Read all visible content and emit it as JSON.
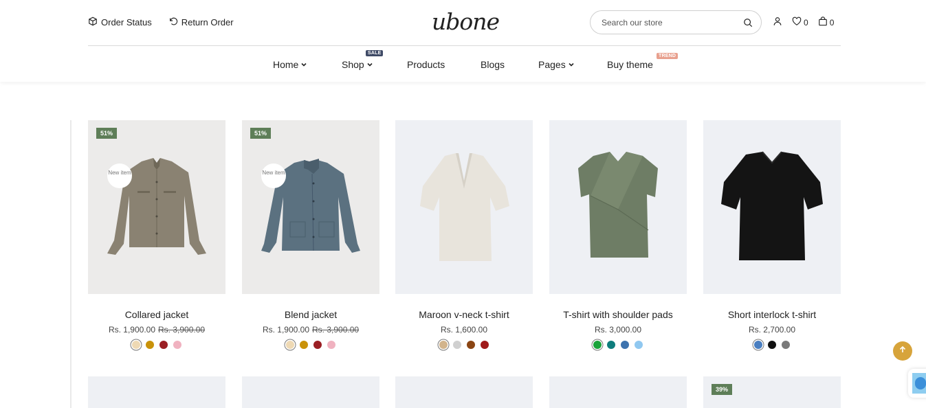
{
  "header": {
    "top_links": [
      {
        "label": "Order Status",
        "icon": "box-icon"
      },
      {
        "label": "Return Order",
        "icon": "undo-icon"
      }
    ],
    "logo": {
      "text": "ubone",
      "dot_color": "#d9a441"
    },
    "search": {
      "placeholder": "Search our store",
      "value": ""
    },
    "wishlist_count": "0",
    "cart_count": "0"
  },
  "nav": {
    "items": [
      {
        "label": "Home",
        "has_dropdown": true
      },
      {
        "label": "Shop",
        "has_dropdown": true,
        "tag": "SALE"
      },
      {
        "label": "Products",
        "has_dropdown": false
      },
      {
        "label": "Blogs",
        "has_dropdown": false
      },
      {
        "label": "Pages",
        "has_dropdown": true
      },
      {
        "label": "Buy theme",
        "has_dropdown": false,
        "tag": "TREND"
      }
    ]
  },
  "products": [
    {
      "title": "Collared jacket",
      "price": "Rs. 1,900.00",
      "old_price": "Rs. 3,900.00",
      "badge": "51%",
      "new_tag": "New item",
      "colors": [
        "#eed9b4",
        "#c9920a",
        "#9b1f24",
        "#f0b2c0"
      ],
      "garment": "jacket-taupe"
    },
    {
      "title": "Blend jacket",
      "price": "Rs. 1,900.00",
      "old_price": "Rs. 3,900.00",
      "badge": "51%",
      "new_tag": "New item",
      "colors": [
        "#eed9b4",
        "#c9920a",
        "#9b1f24",
        "#f0b2c0"
      ],
      "garment": "jacket-blue"
    },
    {
      "title": "Maroon v-neck t-shirt",
      "price": "Rs. 1,600.00",
      "old_price": "",
      "badge": "",
      "new_tag": "",
      "colors": [
        "#d2b48c",
        "#d0d0d0",
        "#8b4513",
        "#a01a1a"
      ],
      "garment": "tee-cream"
    },
    {
      "title": "T-shirt with shoulder pads",
      "price": "Rs. 3,000.00",
      "old_price": "",
      "badge": "",
      "new_tag": "",
      "colors": [
        "#1aa33a",
        "#0f7d7d",
        "#3d73ae",
        "#90c8f0"
      ],
      "garment": "top-green"
    },
    {
      "title": "Short interlock t-shirt",
      "price": "Rs. 2,700.00",
      "old_price": "",
      "badge": "",
      "new_tag": "",
      "colors": [
        "#4a7fc1",
        "#111111",
        "#7a7a7a"
      ],
      "garment": "tee-black"
    }
  ],
  "second_row": {
    "badge": "39%"
  },
  "colors": {
    "accent": "#d7a43b",
    "badge_green": "#5e7e58",
    "sale_tag": "#3f4a66",
    "trend_tag": "#e8a08e"
  }
}
